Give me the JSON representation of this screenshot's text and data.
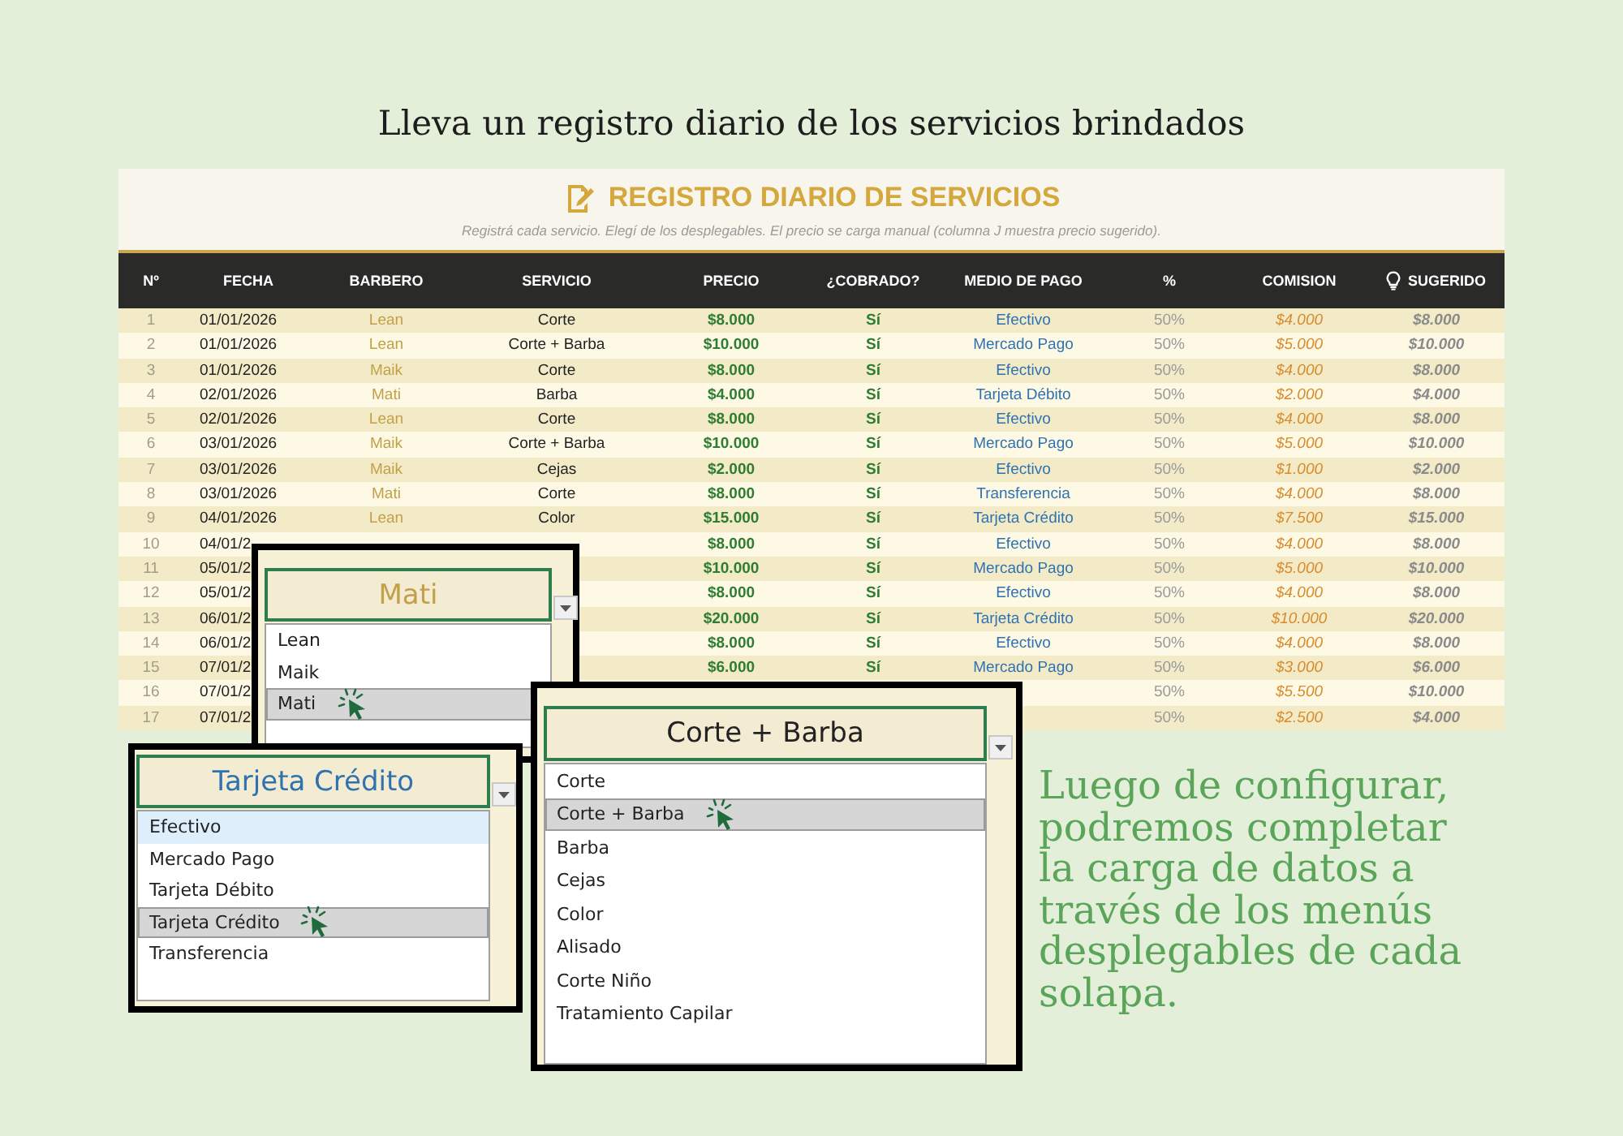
{
  "heading": "Lleva un registro diario de los servicios brindados",
  "sheet": {
    "title": "REGISTRO DIARIO DE SERVICIOS",
    "subtitle": "Registrá cada servicio. Elegí de los desplegables. El precio se carga manual (columna J muestra precio sugerido).",
    "columns": [
      {
        "label": "Nº",
        "kind": "index"
      },
      {
        "label": "FECHA",
        "kind": "date"
      },
      {
        "label": "BARBERO",
        "kind": "barber"
      },
      {
        "label": "SERVICIO",
        "kind": "service"
      },
      {
        "label": "PRECIO",
        "kind": "price"
      },
      {
        "label": "¿COBRADO?",
        "kind": "paid"
      },
      {
        "label": "MEDIO DE PAGO",
        "kind": "method"
      },
      {
        "label": "%",
        "kind": "percent"
      },
      {
        "label": "COMISION",
        "kind": "commission"
      },
      {
        "label": "SUGERIDO",
        "kind": "suggested"
      }
    ],
    "rows": [
      {
        "cells": [
          {
            "kind": "index",
            "text": "1"
          },
          {
            "kind": "date",
            "text": "01/01/2026"
          },
          {
            "kind": "barber",
            "text": "Lean"
          },
          {
            "kind": "service",
            "text": "Corte"
          },
          {
            "kind": "price",
            "text": "$8.000"
          },
          {
            "kind": "paid",
            "text": "Sí"
          },
          {
            "kind": "method",
            "text": "Efectivo"
          },
          {
            "kind": "percent",
            "text": "50%"
          },
          {
            "kind": "commission",
            "text": "$4.000"
          },
          {
            "kind": "suggested",
            "text": "$8.000"
          }
        ]
      },
      {
        "cells": [
          {
            "kind": "index",
            "text": "2"
          },
          {
            "kind": "date",
            "text": "01/01/2026"
          },
          {
            "kind": "barber",
            "text": "Lean"
          },
          {
            "kind": "service",
            "text": "Corte + Barba"
          },
          {
            "kind": "price",
            "text": "$10.000"
          },
          {
            "kind": "paid",
            "text": "Sí"
          },
          {
            "kind": "method",
            "text": "Mercado Pago"
          },
          {
            "kind": "percent",
            "text": "50%"
          },
          {
            "kind": "commission",
            "text": "$5.000"
          },
          {
            "kind": "suggested",
            "text": "$10.000"
          }
        ]
      },
      {
        "cells": [
          {
            "kind": "index",
            "text": "3"
          },
          {
            "kind": "date",
            "text": "01/01/2026"
          },
          {
            "kind": "barber",
            "text": "Maik"
          },
          {
            "kind": "service",
            "text": "Corte"
          },
          {
            "kind": "price",
            "text": "$8.000"
          },
          {
            "kind": "paid",
            "text": "Sí"
          },
          {
            "kind": "method",
            "text": "Efectivo"
          },
          {
            "kind": "percent",
            "text": "50%"
          },
          {
            "kind": "commission",
            "text": "$4.000"
          },
          {
            "kind": "suggested",
            "text": "$8.000"
          }
        ]
      },
      {
        "cells": [
          {
            "kind": "index",
            "text": "4"
          },
          {
            "kind": "date",
            "text": "02/01/2026"
          },
          {
            "kind": "barber",
            "text": "Mati"
          },
          {
            "kind": "service",
            "text": "Barba"
          },
          {
            "kind": "price",
            "text": "$4.000"
          },
          {
            "kind": "paid",
            "text": "Sí"
          },
          {
            "kind": "method",
            "text": "Tarjeta Débito"
          },
          {
            "kind": "percent",
            "text": "50%"
          },
          {
            "kind": "commission",
            "text": "$2.000"
          },
          {
            "kind": "suggested",
            "text": "$4.000"
          }
        ]
      },
      {
        "cells": [
          {
            "kind": "index",
            "text": "5"
          },
          {
            "kind": "date",
            "text": "02/01/2026"
          },
          {
            "kind": "barber",
            "text": "Lean"
          },
          {
            "kind": "service",
            "text": "Corte"
          },
          {
            "kind": "price",
            "text": "$8.000"
          },
          {
            "kind": "paid",
            "text": "Sí"
          },
          {
            "kind": "method",
            "text": "Efectivo"
          },
          {
            "kind": "percent",
            "text": "50%"
          },
          {
            "kind": "commission",
            "text": "$4.000"
          },
          {
            "kind": "suggested",
            "text": "$8.000"
          }
        ]
      },
      {
        "cells": [
          {
            "kind": "index",
            "text": "6"
          },
          {
            "kind": "date",
            "text": "03/01/2026"
          },
          {
            "kind": "barber",
            "text": "Maik"
          },
          {
            "kind": "service",
            "text": "Corte + Barba"
          },
          {
            "kind": "price",
            "text": "$10.000"
          },
          {
            "kind": "paid",
            "text": "Sí"
          },
          {
            "kind": "method",
            "text": "Mercado Pago"
          },
          {
            "kind": "percent",
            "text": "50%"
          },
          {
            "kind": "commission",
            "text": "$5.000"
          },
          {
            "kind": "suggested",
            "text": "$10.000"
          }
        ]
      },
      {
        "cells": [
          {
            "kind": "index",
            "text": "7"
          },
          {
            "kind": "date",
            "text": "03/01/2026"
          },
          {
            "kind": "barber",
            "text": "Maik"
          },
          {
            "kind": "service",
            "text": "Cejas"
          },
          {
            "kind": "price",
            "text": "$2.000"
          },
          {
            "kind": "paid",
            "text": "Sí"
          },
          {
            "kind": "method",
            "text": "Efectivo"
          },
          {
            "kind": "percent",
            "text": "50%"
          },
          {
            "kind": "commission",
            "text": "$1.000"
          },
          {
            "kind": "suggested",
            "text": "$2.000"
          }
        ]
      },
      {
        "cells": [
          {
            "kind": "index",
            "text": "8"
          },
          {
            "kind": "date",
            "text": "03/01/2026"
          },
          {
            "kind": "barber",
            "text": "Mati"
          },
          {
            "kind": "service",
            "text": "Corte"
          },
          {
            "kind": "price",
            "text": "$8.000"
          },
          {
            "kind": "paid",
            "text": "Sí"
          },
          {
            "kind": "method",
            "text": "Transferencia"
          },
          {
            "kind": "percent",
            "text": "50%"
          },
          {
            "kind": "commission",
            "text": "$4.000"
          },
          {
            "kind": "suggested",
            "text": "$8.000"
          }
        ]
      },
      {
        "cells": [
          {
            "kind": "index",
            "text": "9"
          },
          {
            "kind": "date",
            "text": "04/01/2026"
          },
          {
            "kind": "barber",
            "text": "Lean"
          },
          {
            "kind": "service",
            "text": "Color"
          },
          {
            "kind": "price",
            "text": "$15.000"
          },
          {
            "kind": "paid",
            "text": "Sí"
          },
          {
            "kind": "method",
            "text": "Tarjeta Crédito"
          },
          {
            "kind": "percent",
            "text": "50%"
          },
          {
            "kind": "commission",
            "text": "$7.500"
          },
          {
            "kind": "suggested",
            "text": "$15.000"
          }
        ]
      },
      {
        "cells": [
          {
            "kind": "index",
            "text": "10"
          },
          {
            "kind": "date",
            "text": "04/01/2"
          },
          {
            "kind": "price",
            "text": "$8.000"
          },
          {
            "kind": "paid",
            "text": "Sí"
          },
          {
            "kind": "method",
            "text": "Efectivo"
          },
          {
            "kind": "percent",
            "text": "50%"
          },
          {
            "kind": "commission",
            "text": "$4.000"
          },
          {
            "kind": "suggested",
            "text": "$8.000"
          }
        ]
      },
      {
        "cells": [
          {
            "kind": "index",
            "text": "11"
          },
          {
            "kind": "date",
            "text": "05/01/2"
          },
          {
            "kind": "price",
            "text": "$10.000"
          },
          {
            "kind": "paid",
            "text": "Sí"
          },
          {
            "kind": "method",
            "text": "Mercado Pago"
          },
          {
            "kind": "percent",
            "text": "50%"
          },
          {
            "kind": "commission",
            "text": "$5.000"
          },
          {
            "kind": "suggested",
            "text": "$10.000"
          }
        ]
      },
      {
        "cells": [
          {
            "kind": "index",
            "text": "12"
          },
          {
            "kind": "date",
            "text": "05/01/2"
          },
          {
            "kind": "price",
            "text": "$8.000"
          },
          {
            "kind": "paid",
            "text": "Sí"
          },
          {
            "kind": "method",
            "text": "Efectivo"
          },
          {
            "kind": "percent",
            "text": "50%"
          },
          {
            "kind": "commission",
            "text": "$4.000"
          },
          {
            "kind": "suggested",
            "text": "$8.000"
          }
        ]
      },
      {
        "cells": [
          {
            "kind": "index",
            "text": "13"
          },
          {
            "kind": "date",
            "text": "06/01/2"
          },
          {
            "kind": "price",
            "text": "$20.000"
          },
          {
            "kind": "paid",
            "text": "Sí"
          },
          {
            "kind": "method",
            "text": "Tarjeta Crédito"
          },
          {
            "kind": "percent",
            "text": "50%"
          },
          {
            "kind": "commission",
            "text": "$10.000"
          },
          {
            "kind": "suggested",
            "text": "$20.000"
          }
        ]
      },
      {
        "cells": [
          {
            "kind": "index",
            "text": "14"
          },
          {
            "kind": "date",
            "text": "06/01/2"
          },
          {
            "kind": "price",
            "text": "$8.000"
          },
          {
            "kind": "paid",
            "text": "Sí"
          },
          {
            "kind": "method",
            "text": "Efectivo"
          },
          {
            "kind": "percent",
            "text": "50%"
          },
          {
            "kind": "commission",
            "text": "$4.000"
          },
          {
            "kind": "suggested",
            "text": "$8.000"
          }
        ]
      },
      {
        "cells": [
          {
            "kind": "index",
            "text": "15"
          },
          {
            "kind": "date",
            "text": "07/01/2"
          },
          {
            "kind": "price",
            "text": "$6.000"
          },
          {
            "kind": "paid",
            "text": "Sí"
          },
          {
            "kind": "method",
            "text": "Mercado Pago"
          },
          {
            "kind": "percent",
            "text": "50%"
          },
          {
            "kind": "commission",
            "text": "$3.000"
          },
          {
            "kind": "suggested",
            "text": "$6.000"
          }
        ]
      },
      {
        "cells": [
          {
            "kind": "index",
            "text": "16"
          },
          {
            "kind": "date",
            "text": "07/01/2"
          },
          {
            "kind": "percent",
            "text": "50%"
          },
          {
            "kind": "commission",
            "text": "$5.500"
          },
          {
            "kind": "suggested",
            "text": "$10.000"
          }
        ]
      },
      {
        "cells": [
          {
            "kind": "index",
            "text": "17"
          },
          {
            "kind": "date",
            "text": "07/01/2"
          },
          {
            "kind": "percent",
            "text": "50%"
          },
          {
            "kind": "commission",
            "text": "$2.500"
          },
          {
            "kind": "suggested",
            "text": "$4.000"
          }
        ]
      }
    ]
  },
  "dropdowns": [
    {
      "kind": "barber",
      "value": "Mati",
      "options": [
        {
          "label": "Lean",
          "selected": false,
          "focused": false
        },
        {
          "label": "Maik",
          "selected": false,
          "focused": false
        },
        {
          "label": "Mati",
          "selected": true,
          "focused": false
        }
      ]
    },
    {
      "kind": "method",
      "value": "Tarjeta Crédito",
      "options": [
        {
          "label": "Efectivo",
          "selected": false,
          "focused": true
        },
        {
          "label": "Mercado Pago",
          "selected": false,
          "focused": false
        },
        {
          "label": "Tarjeta Débito",
          "selected": false,
          "focused": false
        },
        {
          "label": "Tarjeta Crédito",
          "selected": true,
          "focused": false
        },
        {
          "label": "Transferencia",
          "selected": false,
          "focused": false
        }
      ]
    },
    {
      "kind": "service",
      "value": "Corte + Barba",
      "options": [
        {
          "label": "Corte",
          "selected": false,
          "focused": false
        },
        {
          "label": "Corte + Barba",
          "selected": true,
          "focused": false
        },
        {
          "label": "Barba",
          "selected": false,
          "focused": false
        },
        {
          "label": "Cejas",
          "selected": false,
          "focused": false
        },
        {
          "label": "Color",
          "selected": false,
          "focused": false
        },
        {
          "label": "Alisado",
          "selected": false,
          "focused": false
        },
        {
          "label": "Corte Niño",
          "selected": false,
          "focused": false
        },
        {
          "label": "Tratamiento Capilar",
          "selected": false,
          "focused": false
        }
      ]
    }
  ],
  "caption": "Luego de configurar, podremos completar la carga de datos a través de los menús desplegables de cada solapa."
}
